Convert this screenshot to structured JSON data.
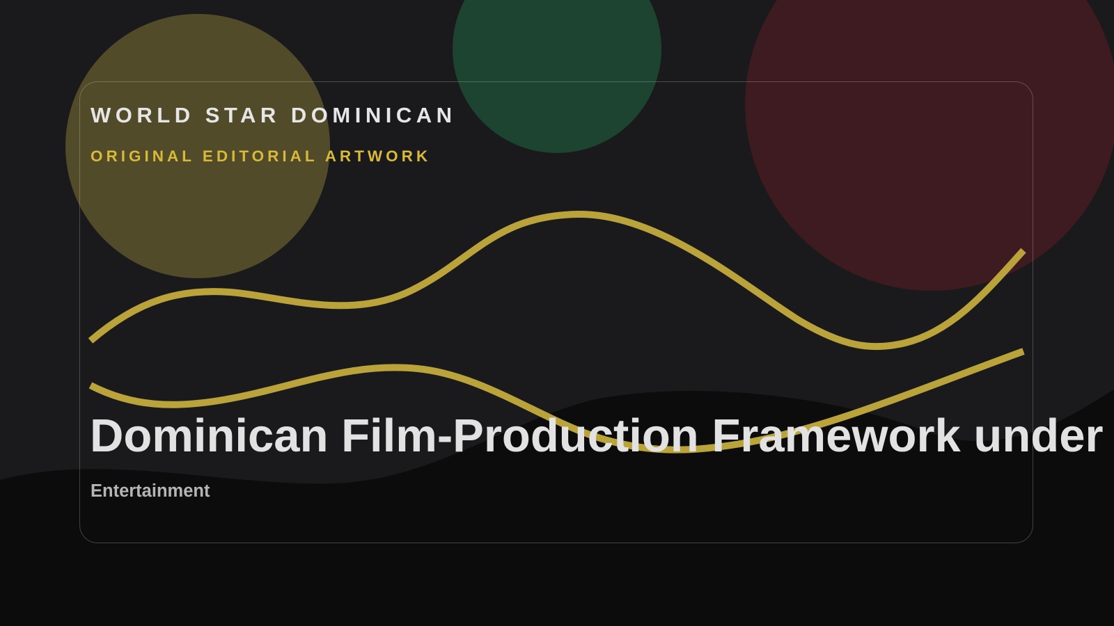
{
  "brand": {
    "name": "WORLD STAR DOMINICAN",
    "tagline": "ORIGINAL EDITORIAL ARTWORK"
  },
  "article": {
    "headline": "Dominican Film-Production Framework under",
    "category": "Entertainment"
  },
  "colors": {
    "background": "#1a1a1c",
    "ground": "#0c0c0c",
    "gold": "#b9a33a",
    "green_circle": "#1c4430",
    "red_circle": "#3e1b20",
    "olive_circle": "#514b2a"
  }
}
